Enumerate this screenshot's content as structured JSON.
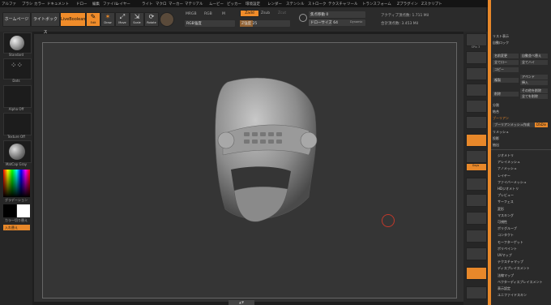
{
  "menubar": {
    "items": [
      "アルファ",
      "ブラシ",
      "カラー",
      "ドキュメント",
      "ドロー",
      "編集",
      "ファイル",
      "レイヤー",
      "ライト",
      "マクロ",
      "マーカー",
      "マテリアル",
      "ムービー",
      "ピッカー",
      "環境設定",
      "レンダー",
      "ステンシル",
      "ストローク",
      "テクスチャ",
      "ツール",
      "トランスフォーム",
      "Zプラグイン",
      "Zスクリプト"
    ]
  },
  "toolbar": {
    "home_label": "ホームページ",
    "lightbox_label": "ライトボックス",
    "liveboolean_label": "LiveBoolean",
    "edit_label": "Edit",
    "draw_label": "Draw",
    "move_label": "Move",
    "scale_label": "Scale",
    "rotate_label": "Rotate",
    "mrgb_label": "MRGB",
    "rgb_label": "RGB",
    "m_label": "M",
    "rgb_strength_label": "RGB強度",
    "zadd_label": "Zadd",
    "zsub_label": "Zsub",
    "zcut_label": "Zcut",
    "z_intensity_label": "Z強度 25",
    "focal_label": "焦点移動 0",
    "draw_size_label": "ドローサイズ 64",
    "dynamic_label": "Dynamic",
    "active_points_label": "アクティブ頂点数: 1.711 Mil",
    "total_points_label": "合計頂点数: 3.453 Mil"
  },
  "leftshelf": {
    "brush_label": "Standard",
    "stroke_label": "Dots",
    "alpha_label": "Alpha Off",
    "texture_label": "Texture Off",
    "material_label": "MatCap Gray",
    "gradient_label": "グラデーション",
    "switch_label": "カラー切り替え",
    "swap_label": "入れ替え"
  },
  "rightshelf": {
    "labels": [
      "SPix 3",
      "",
      "",
      "",
      "",
      "",
      "",
      "",
      "",
      "Gsys",
      "",
      "",
      "",
      "",
      "",
      "",
      "",
      ""
    ]
  },
  "panel": {
    "top_items": [
      "リスト表示",
      "自動ロック",
      "名前変更",
      "全てロー",
      "コピー",
      "複製",
      "削除",
      "分割",
      "結合"
    ],
    "right_items": [
      "自動並べ替え",
      "全てハイ",
      "",
      "アペンド",
      "挿入",
      "その他を削除",
      "全てを削除"
    ],
    "boolean_label": "ブーリアン",
    "boolean_make": "ブーリアンメッシュ作成",
    "boolean_btn": "DSDiv",
    "remesh": "リメッシュ",
    "project": "投影",
    "extract": "抽出",
    "list": [
      "ジオメトリ",
      "アレイメッシュ",
      "ナノメッシュ",
      "レイヤー",
      "ファイバーメッシュ",
      "HDジオメトリ",
      "プレビュー",
      "サーフェス",
      "変形",
      "マスキング",
      "可視性",
      "ポリグループ",
      "コンタクト",
      "モーフターゲット",
      "ポリペイント",
      "UVマップ",
      "テクスチャマップ",
      "ディスプレイスメント",
      "法線マップ",
      "ベクターディスプレイスメント",
      "表示設定",
      "ユニファイドスキン"
    ]
  },
  "viewport": {
    "bottom_handle": "▲▼"
  },
  "colors": {
    "accent": "#f08c2a",
    "canvas": "#353535",
    "cursor": "#c0392b"
  }
}
